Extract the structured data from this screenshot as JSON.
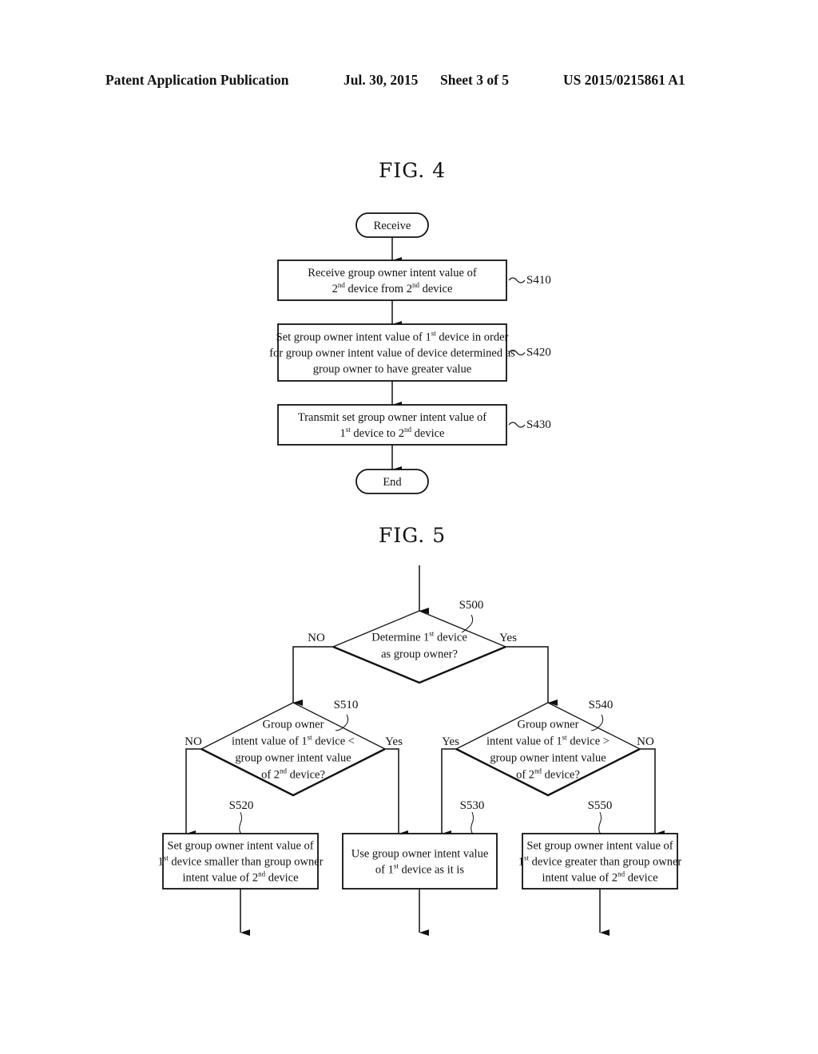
{
  "header": {
    "publication": "Patent Application Publication",
    "date": "Jul. 30, 2015",
    "sheet": "Sheet 3 of 5",
    "number": "US 2015/0215861 A1"
  },
  "fig4": {
    "title": "FIG. 4",
    "start": "Receive",
    "end": "End",
    "steps": [
      {
        "id": "S410",
        "lines": [
          [
            "Receive group owner intent value of"
          ],
          [
            "2",
            "nd",
            " device from 2",
            "nd",
            " device"
          ]
        ]
      },
      {
        "id": "S420",
        "lines": [
          [
            "Set group owner intent value of 1",
            "st",
            "  device in order"
          ],
          [
            "for group owner intent value of device determined as"
          ],
          [
            "group owner to have greater value"
          ]
        ]
      },
      {
        "id": "S430",
        "lines": [
          [
            "Transmit set group owner intent value of"
          ],
          [
            "1",
            "st",
            "  device to 2",
            "nd",
            " device"
          ]
        ]
      }
    ]
  },
  "fig5": {
    "title": "FIG. 5",
    "decisions": [
      {
        "id": "S500",
        "lines": [
          [
            "Determine 1",
            "st",
            "  device"
          ],
          [
            "as group owner?"
          ]
        ],
        "left": "NO",
        "right": "Yes"
      },
      {
        "id": "S510",
        "lines": [
          [
            "Group owner"
          ],
          [
            "intent value of 1",
            "st",
            "  device <"
          ],
          [
            "group owner intent value"
          ],
          [
            "of 2",
            "nd",
            " device?"
          ]
        ],
        "left": "NO",
        "right": "Yes"
      },
      {
        "id": "S540",
        "lines": [
          [
            "Group owner"
          ],
          [
            "intent value of 1",
            "st",
            "  device >"
          ],
          [
            "group owner intent value"
          ],
          [
            "of 2",
            "nd",
            " device?"
          ]
        ],
        "left": "Yes",
        "right": "NO"
      }
    ],
    "processes": [
      {
        "id": "S520",
        "lines": [
          [
            "Set group owner intent value of"
          ],
          [
            "1",
            "st",
            "  device smaller than group owner"
          ],
          [
            "intent value of 2",
            "nd",
            " device"
          ]
        ]
      },
      {
        "id": "S530",
        "lines": [
          [
            "Use group owner intent value"
          ],
          [
            "of 1",
            "st",
            "  device as it is"
          ]
        ]
      },
      {
        "id": "S550",
        "lines": [
          [
            "Set group owner intent value of"
          ],
          [
            "1",
            "st",
            "  device greater than group owner"
          ],
          [
            "intent value of 2",
            "nd",
            " device"
          ]
        ]
      }
    ]
  }
}
